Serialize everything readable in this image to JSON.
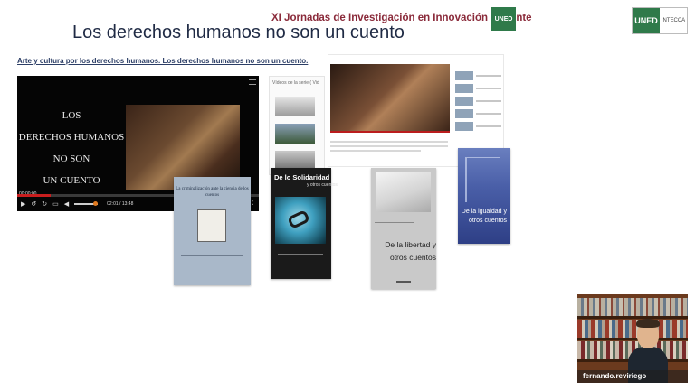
{
  "header": {
    "conference": "XI Jornadas de Investigación en Innovación Docente",
    "uned_badge": "UNED",
    "logo_uned": "UNED",
    "logo_intecca": "INTECCA"
  },
  "slide": {
    "title": "Los derechos humanos no son un cuento",
    "subtitle": "Arte y cultura por los derechos humanos. Los derechos humanos no son un cuento."
  },
  "video": {
    "lines": [
      "LOS",
      "DERECHOS HUMANOS",
      "NO SON",
      "UN CUENTO"
    ],
    "elapsed_badge": "00:00:00",
    "time": "02:01 / 13:48",
    "progress": 0.14
  },
  "series_panel": {
    "header": "Vídeos de la serie ( Vid"
  },
  "books": {
    "book1_title": "La criminalización ante la ciencia de los cuentos",
    "book2_title": "De lo Solidaridad",
    "book2_subtitle": "y otros cuentos",
    "book3_title": "De la libertad y otros cuentos",
    "book4_title": "De la igualdad y otros cuentos"
  },
  "webcam": {
    "name": "fernando.reviriego"
  },
  "icons": {
    "play": "play-icon",
    "rewind": "rewind-icon",
    "forward": "forward-icon",
    "volume": "volume-icon",
    "fullscreen": "fullscreen-icon",
    "menu": "menu-icon"
  },
  "colors": {
    "uned_green": "#2f7a4a",
    "conference_text": "#8a2a3a",
    "title_text": "#1f2a44",
    "progress_red": "#c81e1e"
  }
}
